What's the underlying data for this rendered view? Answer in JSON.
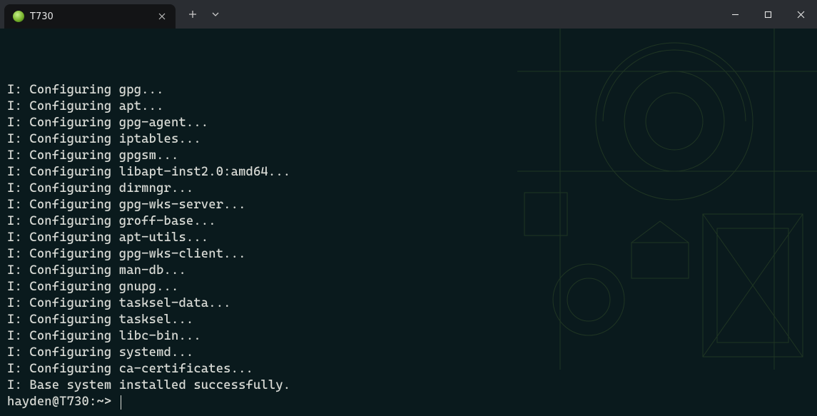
{
  "window": {
    "tab_title": "T730"
  },
  "terminal": {
    "lines": [
      "I: Configuring gpg...",
      "I: Configuring apt...",
      "I: Configuring gpg-agent...",
      "I: Configuring iptables...",
      "I: Configuring gpgsm...",
      "I: Configuring libapt-inst2.0:amd64...",
      "I: Configuring dirmngr...",
      "I: Configuring gpg-wks-server...",
      "I: Configuring groff-base...",
      "I: Configuring apt-utils...",
      "I: Configuring gpg-wks-client...",
      "I: Configuring man-db...",
      "I: Configuring gnupg...",
      "I: Configuring tasksel-data...",
      "I: Configuring tasksel...",
      "I: Configuring libc-bin...",
      "I: Configuring systemd...",
      "I: Configuring ca-certificates...",
      "I: Base system installed successfully."
    ],
    "prompt": "hayden@T730:~> "
  }
}
